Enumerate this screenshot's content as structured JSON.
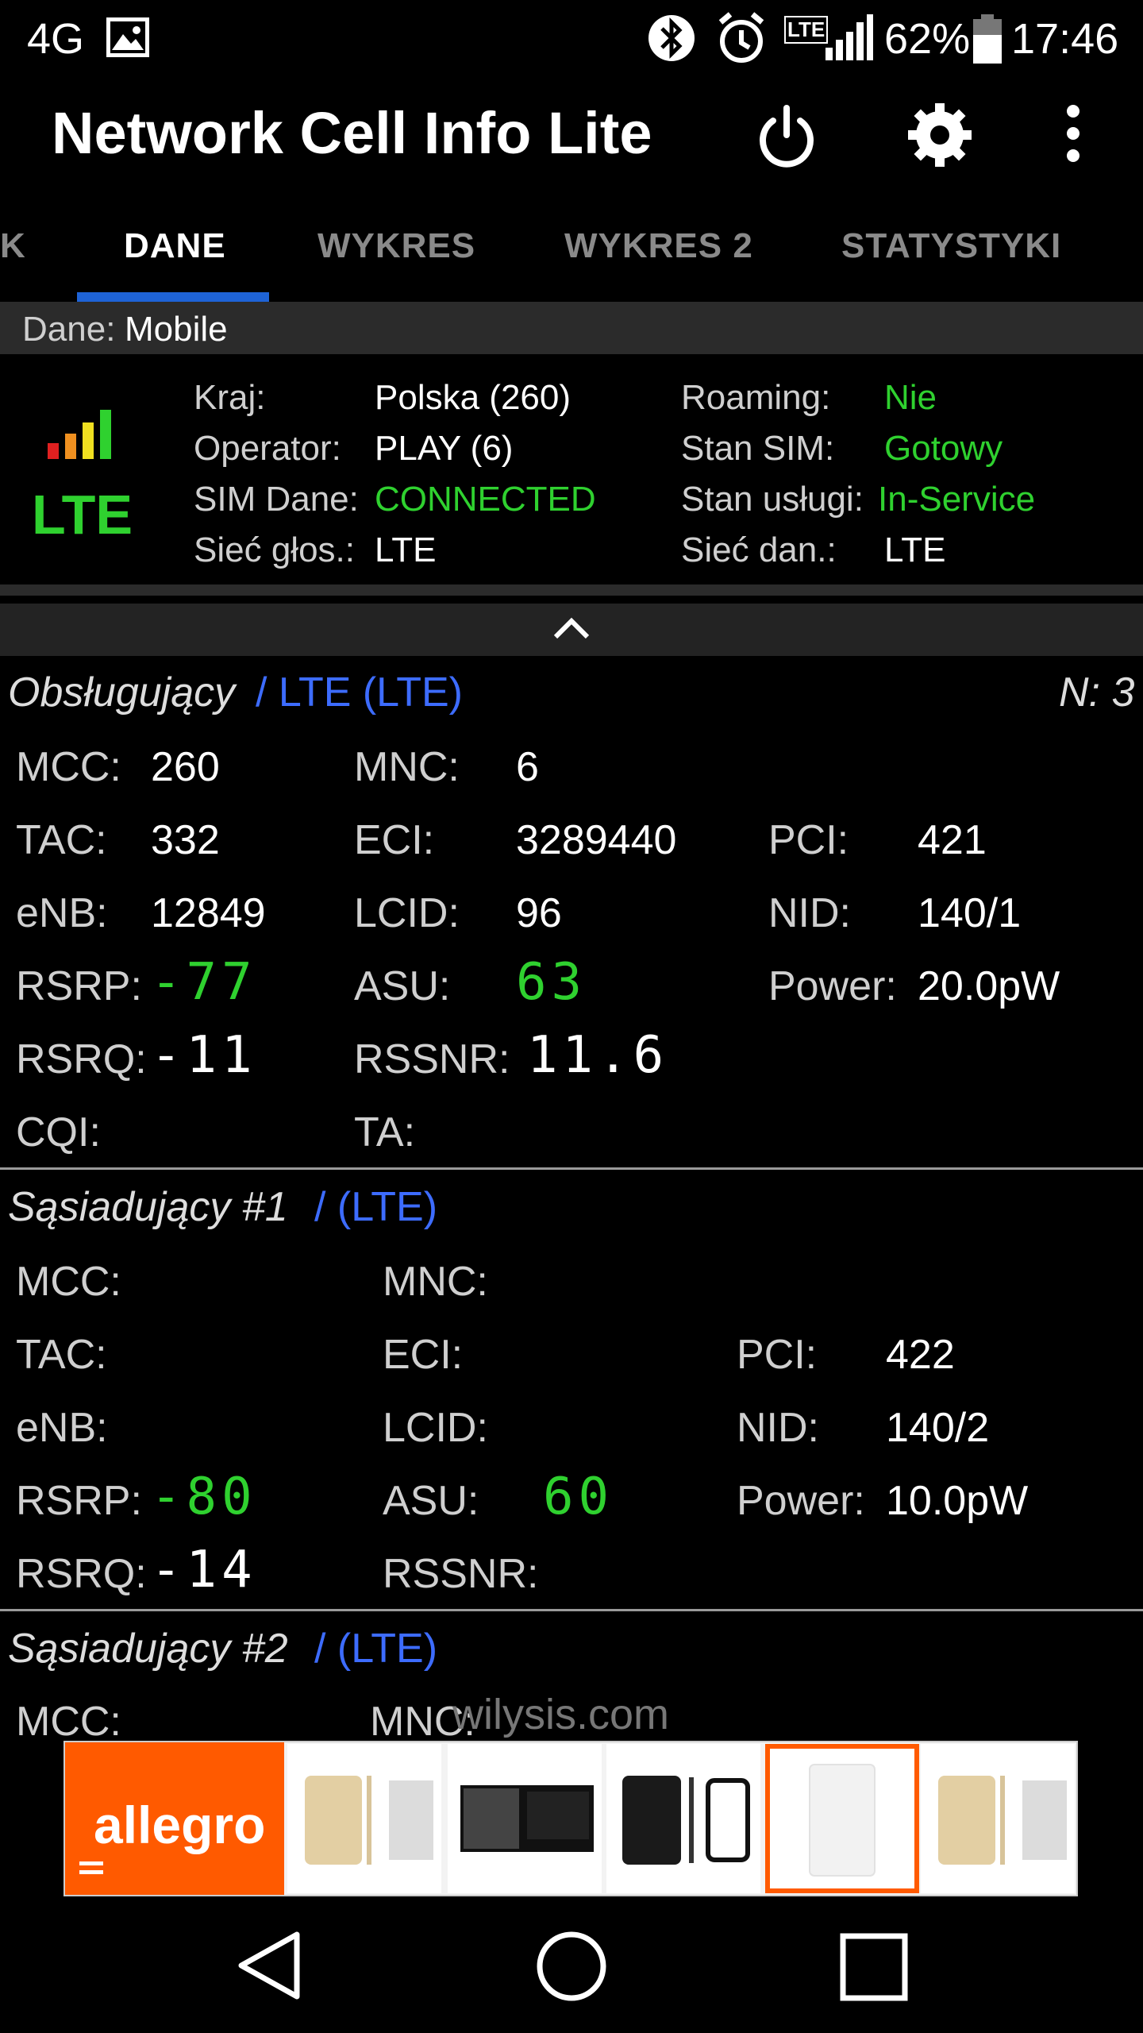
{
  "status_bar": {
    "network": "4G",
    "lte_badge": "LTE",
    "battery": "62%",
    "time": "17:46"
  },
  "app": {
    "title": "Network Cell Info Lite"
  },
  "tabs": [
    {
      "label": "K"
    },
    {
      "label": "DANE"
    },
    {
      "label": "WYKRES"
    },
    {
      "label": "WYKRES 2"
    },
    {
      "label": "STATYSTYKI"
    }
  ],
  "dane_bar": {
    "label": "Dane:",
    "value": "Mobile"
  },
  "info": {
    "tech": "LTE",
    "kraj_label": "Kraj:",
    "kraj": "Polska (260)",
    "operator_label": "Operator:",
    "operator": "PLAY (6)",
    "sim_dane_label": "SIM Dane:",
    "sim_dane": "CONNECTED",
    "siec_glos_label": "Sieć głos.:",
    "siec_glos": "LTE",
    "roaming_label": "Roaming:",
    "roaming": "Nie",
    "stan_sim_label": "Stan SIM:",
    "stan_sim": "Gotowy",
    "stan_uslugi_label": "Stan usługi:",
    "stan_uslugi": "In-Service",
    "siec_dan_label": "Sieć dan.:",
    "siec_dan": "LTE"
  },
  "serving": {
    "title": "Obsługujący",
    "tech": "/ LTE (LTE)",
    "n": "N: 3",
    "mcc_label": "MCC:",
    "mcc": "260",
    "mnc_label": "MNC:",
    "mnc": "6",
    "tac_label": "TAC:",
    "tac": "332",
    "eci_label": "ECI:",
    "eci": "3289440",
    "pci_label": "PCI:",
    "pci": "421",
    "enb_label": "eNB:",
    "enb": "12849",
    "lcid_label": "LCID:",
    "lcid": "96",
    "nid_label": "NID:",
    "nid": "140/1",
    "rsrp_label": "RSRP:",
    "rsrp": "-77",
    "asu_label": "ASU:",
    "asu": "63",
    "power_label": "Power:",
    "power": "20.0pW",
    "rsrq_label": "RSRQ:",
    "rsrq": "-11",
    "rssnr_label": "RSSNR:",
    "rssnr": "11.6",
    "cqi_label": "CQI:",
    "ta_label": "TA:"
  },
  "neighbor1": {
    "title": "Sąsiadujący #1",
    "tech": "/ (LTE)",
    "mcc_label": "MCC:",
    "mnc_label": "MNC:",
    "tac_label": "TAC:",
    "eci_label": "ECI:",
    "pci_label": "PCI:",
    "pci": "422",
    "enb_label": "eNB:",
    "lcid_label": "LCID:",
    "nid_label": "NID:",
    "nid": "140/2",
    "rsrp_label": "RSRP:",
    "rsrp": "-80",
    "asu_label": "ASU:",
    "asu": "60",
    "power_label": "Power:",
    "power": "10.0pW",
    "rsrq_label": "RSRQ:",
    "rsrq": "-14",
    "rssnr_label": "RSSNR:"
  },
  "neighbor2": {
    "title": "Sąsiadujący #2",
    "tech": "/ (LTE)",
    "mcc_label": "MCC:",
    "mnc_label": "MNC:"
  },
  "watermark": "wilysis.com",
  "ad": {
    "brand": "allegro"
  },
  "colors": {
    "accent": "#1e63d6",
    "green": "#2fd12f",
    "blue": "#3d6cff",
    "ad_orange": "#ff5a00"
  }
}
